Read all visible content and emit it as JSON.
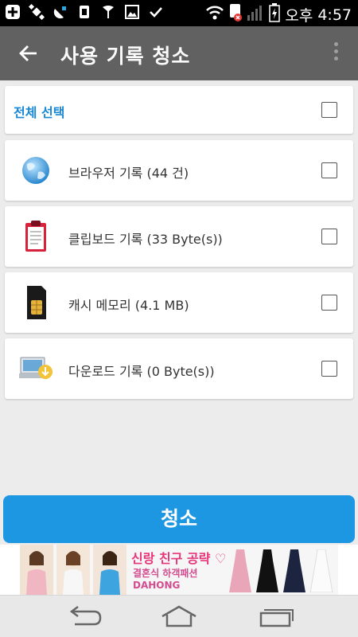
{
  "status_bar": {
    "carrier_text": "오후",
    "time": "4:57",
    "icons": [
      "add-icon",
      "satellite-icon",
      "satellite-dish-icon",
      "sim-card-icon",
      "key-icon",
      "gallery-icon",
      "check-icon",
      "wifi-icon",
      "sim-alert-icon",
      "signal-icon",
      "battery-charging-icon"
    ]
  },
  "app_bar": {
    "back_icon": "back-arrow-icon",
    "title": "사용 기록 청소",
    "menu_icon": "overflow-menu-icon"
  },
  "select_all": {
    "label": "전체 선택",
    "checked": false
  },
  "items": [
    {
      "label": "브라우저 기록 (44 건)",
      "icon": "globe-icon",
      "checked": false
    },
    {
      "label": "클립보드 기록 (33 Byte(s))",
      "icon": "clipboard-icon",
      "checked": false
    },
    {
      "label": "캐시 메모리 (4.1 MB)",
      "icon": "sim-chip-icon",
      "checked": false
    },
    {
      "label": "다운로드 기록 (0 Byte(s))",
      "icon": "download-computer-icon",
      "checked": false
    }
  ],
  "clean_button": {
    "label": "청소"
  },
  "ad": {
    "line1": "신랑 친구 공략 ♡",
    "line2": "결혼식 하객패션",
    "line3": "DAHONG"
  },
  "nav_bar": {
    "icons": [
      "back-nav-icon",
      "home-nav-icon",
      "recents-nav-icon"
    ]
  },
  "colors": {
    "app_bar": "#616161",
    "accent": "#1e97e2",
    "select_all_text": "#1a88d4",
    "background": "#ececec"
  }
}
